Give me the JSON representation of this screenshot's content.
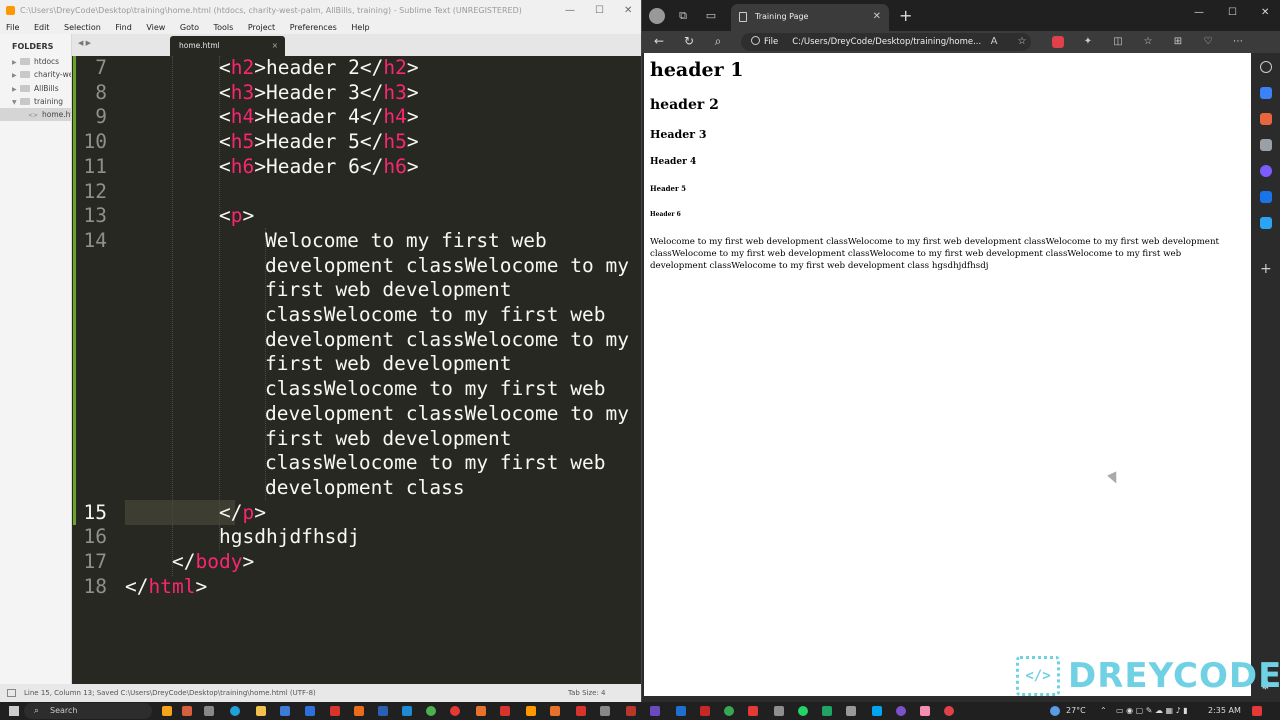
{
  "sublime": {
    "title": "C:\\Users\\DreyCode\\Desktop\\training\\home.html (htdocs, charity-west-palm, AllBills, training) - Sublime Text (UNREGISTERED)",
    "menu": [
      "File",
      "Edit",
      "Selection",
      "Find",
      "View",
      "Goto",
      "Tools",
      "Project",
      "Preferences",
      "Help"
    ],
    "sidebar_header": "FOLDERS",
    "folders": [
      {
        "name": "htdocs",
        "arrow": "▶"
      },
      {
        "name": "charity-west-palm",
        "arrow": "▶"
      },
      {
        "name": "AllBills",
        "arrow": "▶"
      },
      {
        "name": "training",
        "arrow": "▼"
      },
      {
        "name": "home.html",
        "arrow": "<>"
      }
    ],
    "tab_label": "home.html",
    "line_numbers": [
      "7",
      "8",
      "9",
      "10",
      "11",
      "12",
      "13",
      "14",
      "",
      "",
      "",
      "",
      "",
      "",
      "",
      "",
      "",
      "15",
      "16",
      "17",
      "18"
    ],
    "code": {
      "l7a": "<",
      "l7t": "h2",
      "l7b": ">header 2</",
      "l7t2": "h2",
      "l7c": ">",
      "l8a": "<",
      "l8t": "h3",
      "l8b": ">Header 3</",
      "l8t2": "h3",
      "l8c": ">",
      "l9a": "<",
      "l9t": "h4",
      "l9b": ">Header 4</",
      "l9t2": "h4",
      "l9c": ">",
      "l10a": "<",
      "l10t": "h5",
      "l10b": ">Header 5</",
      "l10t2": "h5",
      "l10c": ">",
      "l11a": "<",
      "l11t": "h6",
      "l11b": ">Header 6</",
      "l11t2": "h6",
      "l11c": ">",
      "l13a": "<",
      "l13t": "p",
      "l13c": ">",
      "wrap": [
        "Welocome to my first web",
        "development classWelocome to my",
        "first web development",
        "classWelocome to my first web",
        "development classWelocome to my",
        "first web development",
        "classWelocome to my first web",
        "development classWelocome to my",
        "first web development",
        "classWelocome to my first web",
        "development class"
      ],
      "l15a": "</",
      "l15t": "p",
      "l15c": ">",
      "l16": "hgsdhjdfhsdj",
      "l17a": "</",
      "l17t": "body",
      "l17c": ">",
      "l18a": "</",
      "l18t": "html",
      "l18c": ">"
    },
    "status": "Line 15, Column 13; Saved C:\\Users\\DreyCode\\Desktop\\training\\home.html (UTF-8)",
    "tab_size": "Tab Size: 4"
  },
  "edge": {
    "tab_title": "Training Page",
    "url_scheme": "File",
    "url": "C:/Users/DreyCode/Desktop/training/home...",
    "page": {
      "h1": "header 1",
      "h2": "header 2",
      "h3": "Header 3",
      "h4": "Header 4",
      "h5": "Header 5",
      "h6": "Header 6",
      "p": "Welocome to my first web development classWelocome to my first web development classWelocome to my first web development classWelocome to my first web development classWelocome to my first web development classWelocome to my first web development classWelocome to my first web development class hgsdhjdfhsdj"
    }
  },
  "logo": {
    "mark": "</>",
    "word": "DREYCODE"
  },
  "taskbar": {
    "search": "Search",
    "temp": "27°C",
    "clock": "2:35 AM"
  },
  "colors": {
    "tag": "#f92672",
    "editor_bg": "#272822",
    "logo": "#6fd1e3"
  }
}
